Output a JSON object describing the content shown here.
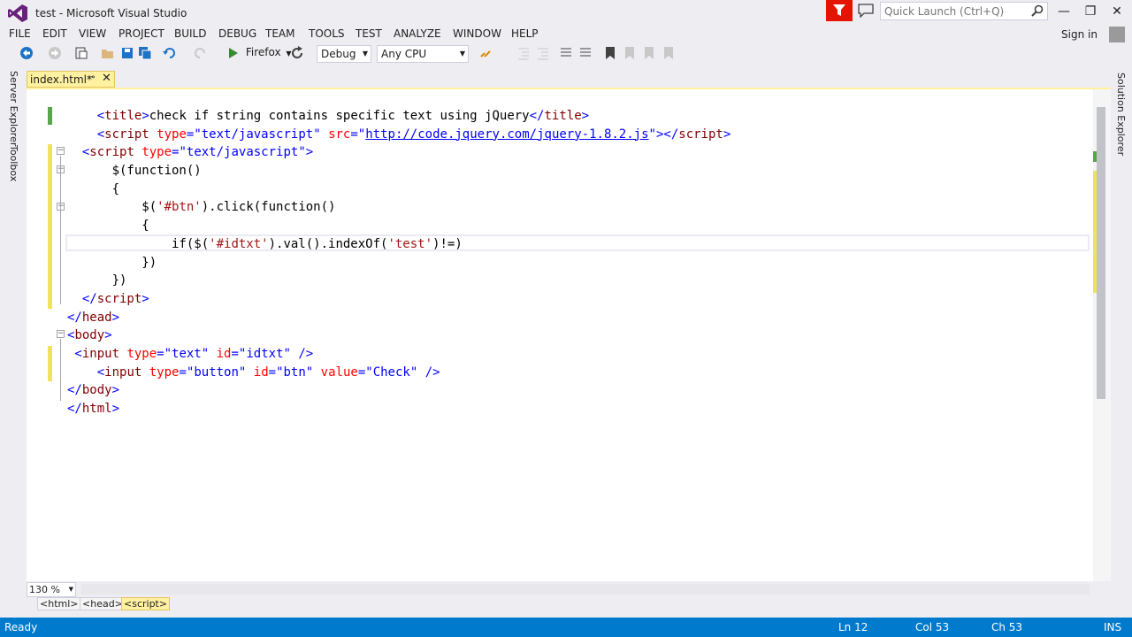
{
  "window": {
    "title": "test - Microsoft Visual Studio",
    "quick_launch_placeholder": "Quick Launch (Ctrl+Q)",
    "minimize": "—",
    "restore": "❐",
    "close": "✕"
  },
  "menu": {
    "items": [
      "FILE",
      "EDIT",
      "VIEW",
      "PROJECT",
      "BUILD",
      "DEBUG",
      "TEAM",
      "TOOLS",
      "TEST",
      "ANALYZE",
      "WINDOW",
      "HELP"
    ],
    "sign_in": "Sign in"
  },
  "toolbar": {
    "run_target": "Firefox",
    "configuration": "Debug",
    "platform": "Any CPU"
  },
  "side_tabs": {
    "left": [
      "Server Explorer",
      "Toolbox"
    ],
    "right": [
      "Solution Explorer"
    ]
  },
  "document_tab": {
    "label": "index.html*",
    "pin": "⊸",
    "close": "✕"
  },
  "editor": {
    "lines": [
      [
        [
          "br",
          "    <"
        ],
        [
          "tag",
          "title"
        ],
        [
          "br",
          ">"
        ],
        [
          "tx",
          "check if string contains specific text using jQuery"
        ],
        [
          "br",
          "</"
        ],
        [
          "tag",
          "title"
        ],
        [
          "br",
          ">"
        ]
      ],
      [
        [
          "br",
          "    <"
        ],
        [
          "tag",
          "script"
        ],
        [
          "tx",
          " "
        ],
        [
          "at",
          "type"
        ],
        [
          "br",
          "="
        ],
        [
          "av",
          "\"text/javascript\""
        ],
        [
          "tx",
          " "
        ],
        [
          "at",
          "src"
        ],
        [
          "br",
          "="
        ],
        [
          "av",
          "\""
        ],
        [
          "ln",
          "http://code.jquery.com/jquery-1.8.2.js"
        ],
        [
          "av",
          "\""
        ],
        [
          "br",
          "></"
        ],
        [
          "tag",
          "script"
        ],
        [
          "br",
          ">"
        ]
      ],
      [
        [
          "br",
          "  <"
        ],
        [
          "tag",
          "script"
        ],
        [
          "tx",
          " "
        ],
        [
          "at",
          "type"
        ],
        [
          "br",
          "="
        ],
        [
          "av",
          "\"text/javascript\""
        ],
        [
          "br",
          ">"
        ]
      ],
      [
        [
          "tx",
          "      $(function()"
        ]
      ],
      [
        [
          "tx",
          "      {"
        ]
      ],
      [
        [
          "tx",
          "          $("
        ],
        [
          "st",
          "'#btn'"
        ],
        [
          "tx",
          ").click(function()"
        ]
      ],
      [
        [
          "tx",
          "          {"
        ]
      ],
      [
        [
          "tx",
          "              if($("
        ],
        [
          "st",
          "'#idtxt'"
        ],
        [
          "tx",
          ").val().indexOf("
        ],
        [
          "st",
          "'test'"
        ],
        [
          "tx",
          ")!=)"
        ]
      ],
      [
        [
          "tx",
          "          })"
        ]
      ],
      [
        [
          "tx",
          "      })"
        ]
      ],
      [
        [
          "br",
          "  </"
        ],
        [
          "tag",
          "script"
        ],
        [
          "br",
          ">"
        ]
      ],
      [
        [
          "br",
          "</"
        ],
        [
          "tag",
          "head"
        ],
        [
          "br",
          ">"
        ]
      ],
      [
        [
          "br",
          "<"
        ],
        [
          "tag",
          "body"
        ],
        [
          "br",
          ">"
        ]
      ],
      [
        [
          "br",
          " <"
        ],
        [
          "tag",
          "input"
        ],
        [
          "tx",
          " "
        ],
        [
          "at",
          "type"
        ],
        [
          "br",
          "="
        ],
        [
          "av",
          "\"text\""
        ],
        [
          "tx",
          " "
        ],
        [
          "at",
          "id"
        ],
        [
          "br",
          "="
        ],
        [
          "av",
          "\"idtxt\""
        ],
        [
          "tx",
          " "
        ],
        [
          "br",
          "/>"
        ]
      ],
      [
        [
          "br",
          "    <"
        ],
        [
          "tag",
          "input"
        ],
        [
          "tx",
          " "
        ],
        [
          "at",
          "type"
        ],
        [
          "br",
          "="
        ],
        [
          "av",
          "\"button\""
        ],
        [
          "tx",
          " "
        ],
        [
          "at",
          "id"
        ],
        [
          "br",
          "="
        ],
        [
          "av",
          "\"btn\""
        ],
        [
          "tx",
          " "
        ],
        [
          "at",
          "value"
        ],
        [
          "br",
          "="
        ],
        [
          "av",
          "\"Check\""
        ],
        [
          "tx",
          " "
        ],
        [
          "br",
          "/>"
        ]
      ],
      [
        [
          "br",
          "</"
        ],
        [
          "tag",
          "body"
        ],
        [
          "br",
          ">"
        ]
      ],
      [
        [
          "br",
          "</"
        ],
        [
          "tag",
          "html"
        ],
        [
          "br",
          ">"
        ]
      ]
    ],
    "zoom": "130 %",
    "breadcrumbs": [
      "<html>",
      "<head>",
      "<script>"
    ]
  },
  "status": {
    "state": "Ready",
    "line": "Ln 12",
    "col": "Col 53",
    "ch": "Ch 53",
    "mode": "INS"
  },
  "colors": {
    "accent": "#007acc",
    "tag": "#800000",
    "attribute": "#ff0000",
    "value": "#0000ff",
    "changed_bar": "#efe25c",
    "saved_bar": "#57a64a",
    "feedback": "#e51400"
  }
}
